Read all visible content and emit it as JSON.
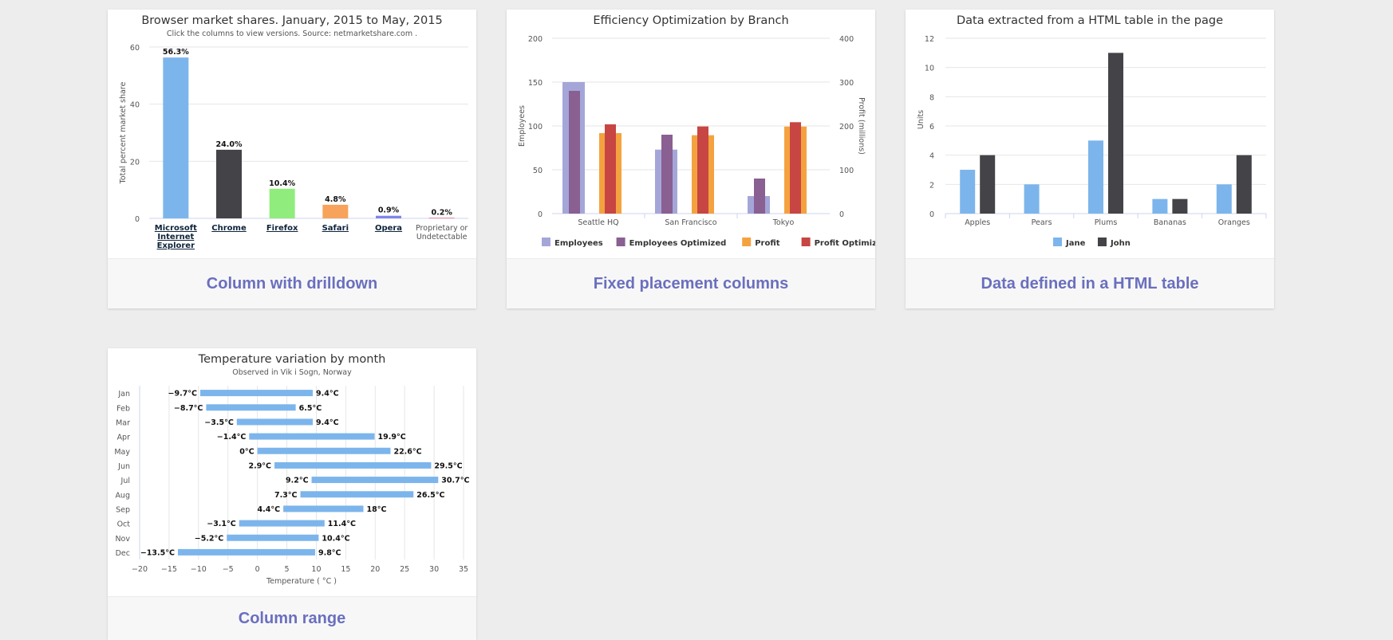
{
  "cards": [
    {
      "caption": "Column with drilldown",
      "chart_data": {
        "type": "bar",
        "title": "Browser market shares. January, 2015 to May, 2015",
        "subtitle": "Click the columns to view versions. Source: netmarketshare.com .",
        "ylabel": "Total percent market share",
        "ylim": [
          0,
          60
        ],
        "yticks": [
          0,
          20,
          40,
          60
        ],
        "grid": true,
        "categories": [
          "Microsoft Internet Explorer",
          "Chrome",
          "Firefox",
          "Safari",
          "Opera",
          "Proprietary or Undetectable"
        ],
        "category_lines": [
          [
            "Microsoft",
            "Internet",
            "Explorer"
          ],
          [
            "Chrome"
          ],
          [
            "Firefox"
          ],
          [
            "Safari"
          ],
          [
            "Opera"
          ],
          [
            "Proprietary or",
            "Undetectable"
          ]
        ],
        "drilldown": [
          true,
          true,
          true,
          true,
          true,
          false
        ],
        "values": [
          56.33,
          24.03,
          10.38,
          4.77,
          0.91,
          0.2
        ],
        "data_labels": [
          "56.3%",
          "24.0%",
          "10.4%",
          "4.8%",
          "0.9%",
          "0.2%"
        ],
        "colors": [
          "#7cb5ec",
          "#434348",
          "#90ed7d",
          "#f7a35c",
          "#8085e9",
          "#f15c80"
        ]
      }
    },
    {
      "caption": "Fixed placement columns",
      "chart_data": {
        "type": "bar",
        "title": "Efficiency Optimization by Branch",
        "ylabel": "Employees",
        "y2label": "Profit (millions)",
        "ylim": [
          0,
          200
        ],
        "y2lim": [
          0,
          400
        ],
        "yticks": [
          0,
          50,
          100,
          150,
          200
        ],
        "y2ticks": [
          0,
          100,
          200,
          300,
          400
        ],
        "grid": true,
        "legend_position": "bottom",
        "categories": [
          "Seattle HQ",
          "San Francisco",
          "Tokyo"
        ],
        "series": [
          {
            "name": "Employees",
            "axis": "left",
            "values": [
              150,
              73,
              20
            ],
            "color": "#a5a6d8"
          },
          {
            "name": "Employees Optimized",
            "axis": "left",
            "values": [
              140,
              90,
              40
            ],
            "color": "#8a5f92"
          },
          {
            "name": "Profit",
            "axis": "right",
            "values": [
              183.6,
              178.8,
              198.5
            ],
            "color": "#f4a23f"
          },
          {
            "name": "Profit Optimized",
            "axis": "right",
            "values": [
              203.6,
              198.8,
              208.5
            ],
            "color": "#c74542"
          }
        ]
      }
    },
    {
      "caption": "Data defined in a HTML table",
      "chart_data": {
        "type": "bar",
        "title": "Data extracted from a HTML table in the page",
        "ylabel": "Units",
        "ylim": [
          0,
          12
        ],
        "yticks": [
          0,
          2,
          4,
          6,
          8,
          10,
          12
        ],
        "grid": true,
        "legend_position": "bottom",
        "categories": [
          "Apples",
          "Pears",
          "Plums",
          "Bananas",
          "Oranges"
        ],
        "series": [
          {
            "name": "Jane",
            "values": [
              3,
              2,
              5,
              1,
              2
            ],
            "color": "#7cb5ec"
          },
          {
            "name": "John",
            "values": [
              4,
              0,
              11,
              1,
              4
            ],
            "color": "#434348"
          }
        ]
      }
    },
    {
      "caption": "Column range",
      "chart_data": {
        "type": "bar",
        "orientation": "horizontal-range",
        "title": "Temperature variation by month",
        "subtitle": "Observed in Vik i Sogn, Norway",
        "xlabel": "Temperature ( °C )",
        "xlim": [
          -20,
          35
        ],
        "xticks": [
          -20,
          -15,
          -10,
          -5,
          0,
          5,
          10,
          15,
          20,
          25,
          30,
          35
        ],
        "xtick_labels": [
          "−20",
          "−15",
          "−10",
          "−5",
          "0",
          "5",
          "10",
          "15",
          "20",
          "25",
          "30",
          "35"
        ],
        "grid": true,
        "color": "#7cb5ec",
        "categories": [
          "Jan",
          "Feb",
          "Mar",
          "Apr",
          "May",
          "Jun",
          "Jul",
          "Aug",
          "Sep",
          "Oct",
          "Nov",
          "Dec"
        ],
        "low": [
          -9.7,
          -8.7,
          -3.5,
          -1.4,
          0,
          2.9,
          9.2,
          7.3,
          4.4,
          -3.1,
          -5.2,
          -13.5
        ],
        "high": [
          9.4,
          6.5,
          9.4,
          19.9,
          22.6,
          29.5,
          30.7,
          26.5,
          18,
          11.4,
          10.4,
          9.8
        ],
        "low_labels": [
          "−9.7°C",
          "−8.7°C",
          "−3.5°C",
          "−1.4°C",
          "0°C",
          "2.9°C",
          "9.2°C",
          "7.3°C",
          "4.4°C",
          "−3.1°C",
          "−5.2°C",
          "−13.5°C"
        ],
        "high_labels": [
          "9.4°C",
          "6.5°C",
          "9.4°C",
          "19.9°C",
          "22.6°C",
          "29.5°C",
          "30.7°C",
          "26.5°C",
          "18°C",
          "11.4°C",
          "10.4°C",
          "9.8°C"
        ]
      }
    }
  ]
}
